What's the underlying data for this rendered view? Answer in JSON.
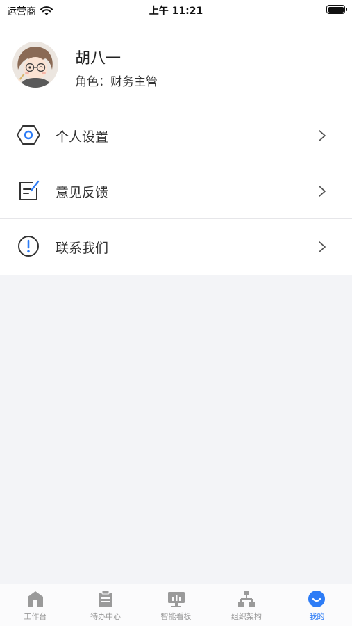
{
  "status_bar": {
    "carrier": "运营商",
    "time": "上午 11:21"
  },
  "profile": {
    "name": "胡八一",
    "role": "角色：财务主管"
  },
  "menu": {
    "items": [
      {
        "label": "个人设置",
        "icon": "hexagon-settings-icon"
      },
      {
        "label": "意见反馈",
        "icon": "edit-note-icon"
      },
      {
        "label": "联系我们",
        "icon": "info-exclamation-icon"
      }
    ]
  },
  "tabbar": {
    "active": "我的",
    "active_color": "#2d7cf6",
    "inactive_color": "#999999",
    "items": [
      {
        "label": "工作台",
        "icon": "home-icon"
      },
      {
        "label": "待办中心",
        "icon": "clipboard-icon"
      },
      {
        "label": "智能看板",
        "icon": "dashboard-icon"
      },
      {
        "label": "组织架构",
        "icon": "org-chart-icon"
      },
      {
        "label": "我的",
        "icon": "smile-user-icon"
      }
    ]
  }
}
